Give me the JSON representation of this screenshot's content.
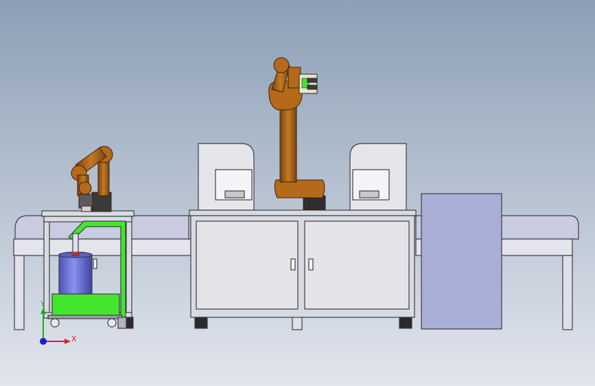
{
  "viewport": {
    "background_top": "#8c9fb5",
    "background_bottom": "#e2e6ee"
  },
  "triad": {
    "x_label": "X",
    "y_label": "Y",
    "x_color": "#e02020",
    "y_color": "#18b018",
    "z_color": "#1a1ae6"
  },
  "colors": {
    "robot_orange": "#b56a1a",
    "robot_dark": "#3a3a3a",
    "frame": "#d8dbe2",
    "frame_stroke": "#3c3c44",
    "cabinet_panel": "#e4e4e8",
    "conveyor_belt": "#c9cbe0",
    "green_part": "#43e62b",
    "barrel_blue": "#6b74d6",
    "enclosure": "#e6e6ea",
    "side_box": "#a9aed6"
  }
}
